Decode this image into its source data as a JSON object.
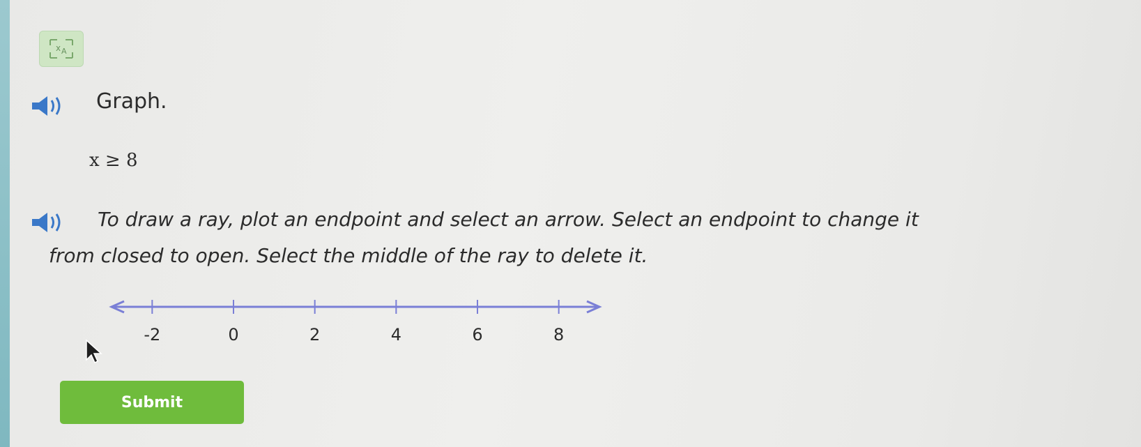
{
  "prompt": {
    "title": "Graph.",
    "inequality": "x ≥ 8"
  },
  "instructions": {
    "line1": "To draw a ray, plot an endpoint and select an arrow. Select an endpoint to change it",
    "line2": "from closed to open. Select the middle of the ray to delete it."
  },
  "number_line": {
    "ticks": [
      -2,
      0,
      2,
      4,
      6,
      8
    ],
    "tick_labels": [
      "-2",
      "0",
      "2",
      "4",
      "6",
      "8"
    ],
    "min": -3,
    "max": 9,
    "color": "#7a7fd6"
  },
  "icons": {
    "translate": "translate-icon",
    "speaker": "speaker-icon",
    "cursor": "mouse-pointer-icon"
  },
  "submit": {
    "label": "Submit",
    "color": "#6fbc3c"
  }
}
